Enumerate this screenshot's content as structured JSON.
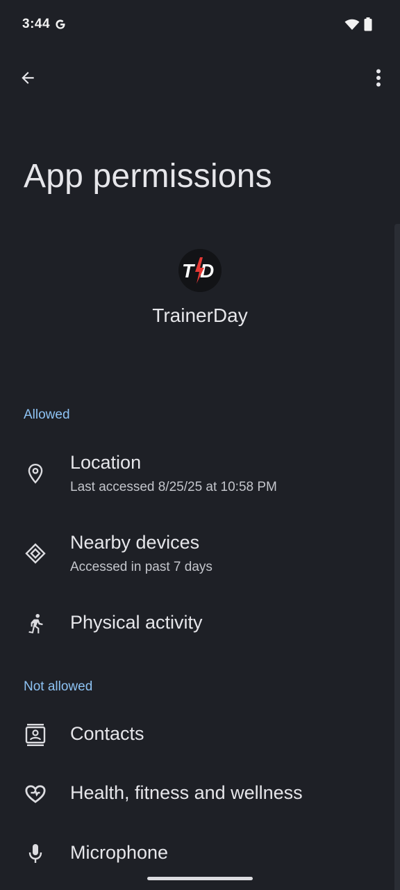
{
  "status_bar": {
    "time": "3:44"
  },
  "header": {
    "title": "App permissions"
  },
  "app": {
    "name": "TrainerDay",
    "icon_letters": "T/D"
  },
  "sections": {
    "allowed": {
      "header": "Allowed",
      "items": [
        {
          "label": "Location",
          "subtitle": "Last accessed 8/25/25 at 10:58 PM",
          "icon": "location-pin-icon"
        },
        {
          "label": "Nearby devices",
          "subtitle": "Accessed in past 7 days",
          "icon": "nearby-devices-icon"
        },
        {
          "label": "Physical activity",
          "icon": "running-person-icon"
        }
      ]
    },
    "not_allowed": {
      "header": "Not allowed",
      "items": [
        {
          "label": "Contacts",
          "icon": "contacts-icon"
        },
        {
          "label": "Health, fitness and wellness",
          "icon": "health-heart-icon"
        },
        {
          "label": "Microphone",
          "icon": "microphone-icon"
        }
      ]
    }
  },
  "colors": {
    "background": "#1e2026",
    "section_header": "#8ec3f4",
    "text_primary": "#e6e6ea",
    "text_secondary": "#c4c6cc",
    "icon_accent": "#e53935"
  }
}
